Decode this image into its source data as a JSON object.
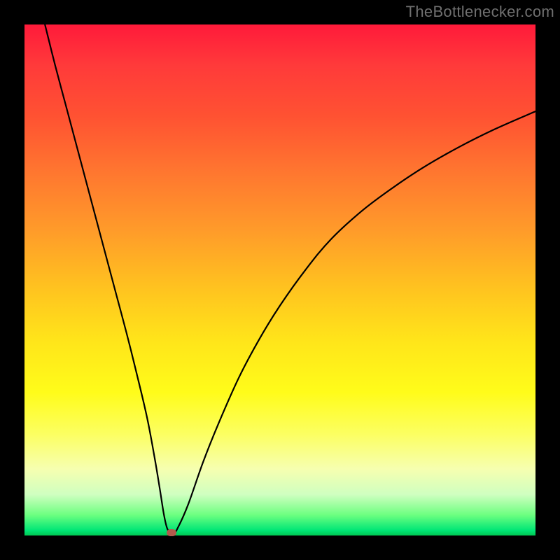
{
  "watermark": "TheBottlenecker.com",
  "chart_data": {
    "type": "line",
    "title": "",
    "xlabel": "",
    "ylabel": "",
    "xlim": [
      0,
      100
    ],
    "ylim": [
      0,
      100
    ],
    "series": [
      {
        "name": "bottleneck-curve",
        "x": [
          4,
          6,
          8,
          10,
          12,
          14,
          16,
          18,
          20,
          22,
          24,
          25.5,
          26.5,
          27.3,
          28,
          29,
          30,
          32,
          35,
          38,
          42,
          46,
          50,
          55,
          60,
          66,
          72,
          78,
          85,
          92,
          100
        ],
        "y": [
          100,
          92,
          84.5,
          77,
          69.5,
          62,
          54.5,
          47,
          39.5,
          31.5,
          23,
          15,
          9,
          4,
          1.2,
          0.2,
          1.5,
          6,
          14.5,
          22,
          31,
          38.5,
          45,
          52,
          58,
          63.5,
          68,
          72,
          76,
          79.5,
          83
        ]
      }
    ],
    "marker": {
      "x": 28.8,
      "y": 0.6,
      "color": "#b35a4d"
    }
  },
  "colors": {
    "curve": "#000000",
    "marker": "#b35a4d"
  }
}
